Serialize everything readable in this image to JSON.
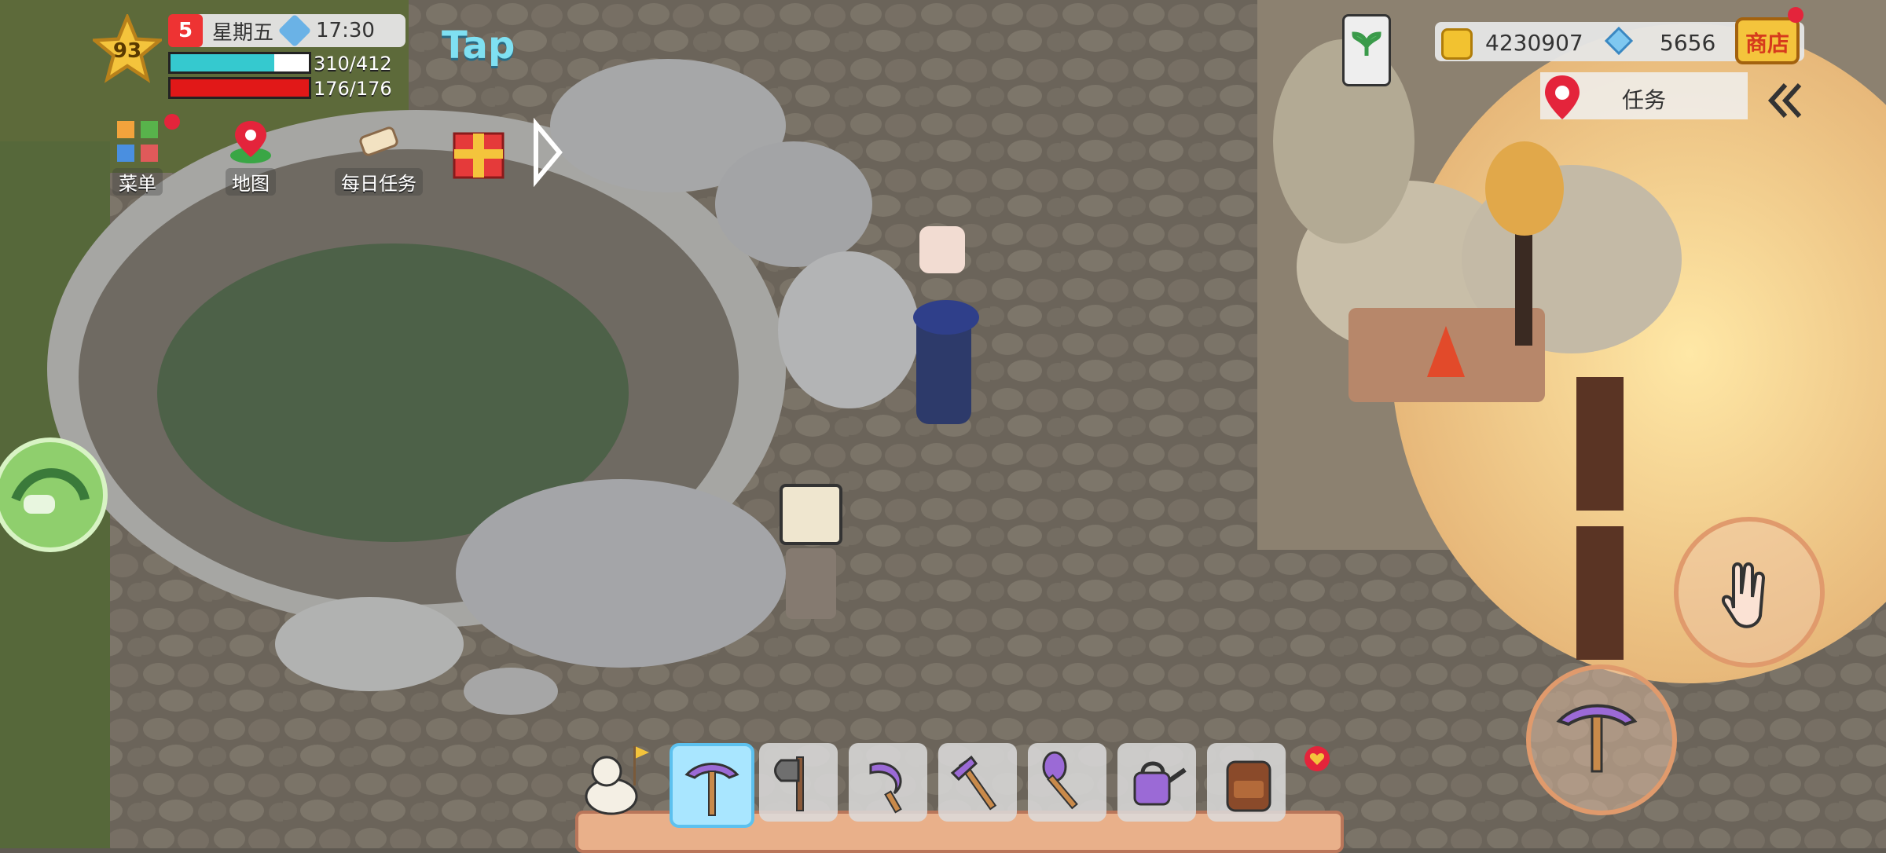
{
  "hud": {
    "level": "93",
    "calendar_day": "5",
    "weekday": "星期五",
    "time": "17:30",
    "stamina": "310/412",
    "stamina_fraction": 0.75,
    "health": "176/176",
    "health_fraction": 1.0,
    "tap_text": "Tap",
    "quick_buttons": [
      {
        "label": "菜单",
        "icon": "menu-grid-icon"
      },
      {
        "label": "地图",
        "icon": "map-pin-icon"
      },
      {
        "label": "每日任务",
        "icon": "scroll-icon"
      }
    ],
    "gift_icon": "gift-box-icon"
  },
  "resources": {
    "gold": "4230907",
    "gems": "5656",
    "shop_label": "商店"
  },
  "quest": {
    "label": "任务"
  },
  "toolbar": {
    "items": [
      {
        "name": "pickaxe",
        "selected": true
      },
      {
        "name": "axe",
        "selected": false
      },
      {
        "name": "sickle",
        "selected": false
      },
      {
        "name": "hoe",
        "selected": false
      },
      {
        "name": "shovel",
        "selected": false
      },
      {
        "name": "watering-can",
        "selected": false
      },
      {
        "name": "backpack",
        "selected": false
      }
    ]
  },
  "colors": {
    "stamina": "#35c9cf",
    "health": "#e11818",
    "accent": "#e09a6c",
    "selected_slot": "#a9e6ff"
  }
}
